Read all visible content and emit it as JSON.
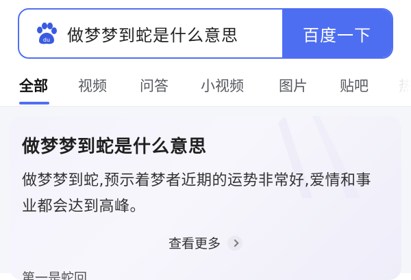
{
  "search": {
    "query": "做梦梦到蛇是什么意思",
    "button_label": "百度一下",
    "logo_icon": "baidu-paw-icon",
    "accent": "#4e6ef2"
  },
  "tabs": [
    {
      "label": "全部",
      "active": true
    },
    {
      "label": "视频",
      "active": false
    },
    {
      "label": "问答",
      "active": false
    },
    {
      "label": "小视频",
      "active": false
    },
    {
      "label": "图片",
      "active": false
    },
    {
      "label": "贴吧",
      "active": false
    },
    {
      "label": "热",
      "active": false
    }
  ],
  "answer_card": {
    "title": "做梦梦到蛇是什么意思",
    "body": "做梦梦到蛇,预示着梦者近期的运势非常好,爱情和事业都会达到高峰。",
    "see_more": "查看更多",
    "next_line_partial": "第一是蛇回"
  }
}
